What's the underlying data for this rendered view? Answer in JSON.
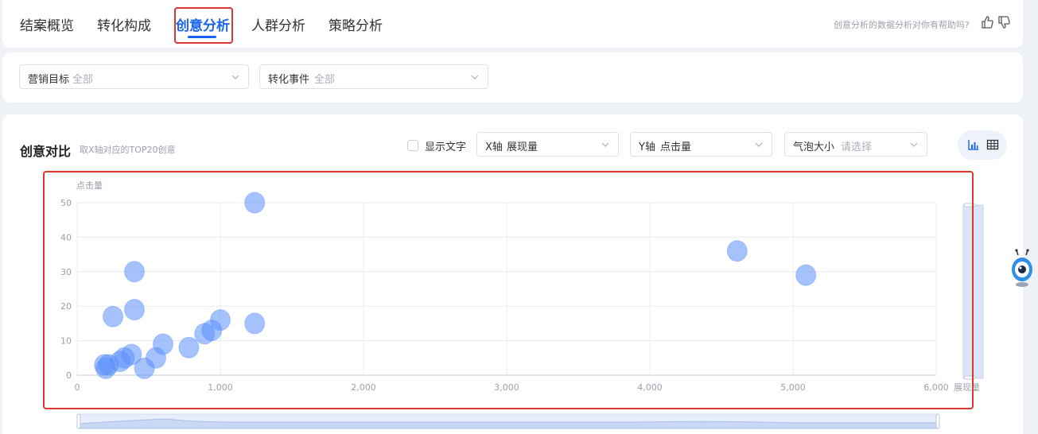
{
  "tabs": [
    {
      "label": "结案概览",
      "active": false
    },
    {
      "label": "转化构成",
      "active": false
    },
    {
      "label": "创意分析",
      "active": true
    },
    {
      "label": "人群分析",
      "active": false
    },
    {
      "label": "策略分析",
      "active": false
    }
  ],
  "help": {
    "question": "创意分析的数据分析对你有帮助吗?",
    "like_icon": "thumbs-up-icon",
    "dislike_icon": "thumbs-down-icon"
  },
  "filters": {
    "marketing_goal": {
      "label": "营销目标",
      "value": "全部"
    },
    "conversion_event": {
      "label": "转化事件",
      "value": "全部"
    }
  },
  "section": {
    "title": "创意对比",
    "subtitle": "取X轴对应的TOP20创意",
    "show_text_label": "显示文字",
    "show_text_checked": false,
    "x_axis": {
      "label": "X轴",
      "value": "展现量"
    },
    "y_axis": {
      "label": "Y轴",
      "value": "点击量"
    },
    "bubble_size": {
      "label": "气泡大小",
      "placeholder": "请选择"
    },
    "view_icons": [
      "bar-chart-icon",
      "table-icon"
    ]
  },
  "colors": {
    "accent": "#1764f0",
    "bubble": "#5b8ff9",
    "highlight_box": "#d93a2c"
  },
  "chart_data": {
    "type": "scatter",
    "xlabel": "展现量",
    "ylabel": "点击量",
    "xlim": [
      0,
      6000
    ],
    "ylim": [
      0,
      50
    ],
    "x_ticks": [
      "0",
      "1,000",
      "2,000",
      "3,000",
      "4,000",
      "5,000",
      "6,000"
    ],
    "y_ticks": [
      "0",
      "10",
      "20",
      "30",
      "40",
      "50"
    ],
    "grid": true,
    "points": [
      {
        "x": 1240,
        "y": 50
      },
      {
        "x": 4610,
        "y": 36
      },
      {
        "x": 5090,
        "y": 29
      },
      {
        "x": 400,
        "y": 30
      },
      {
        "x": 400,
        "y": 19
      },
      {
        "x": 250,
        "y": 17
      },
      {
        "x": 1000,
        "y": 16
      },
      {
        "x": 1240,
        "y": 15
      },
      {
        "x": 940,
        "y": 13
      },
      {
        "x": 890,
        "y": 12
      },
      {
        "x": 600,
        "y": 9
      },
      {
        "x": 780,
        "y": 8
      },
      {
        "x": 380,
        "y": 6
      },
      {
        "x": 550,
        "y": 5
      },
      {
        "x": 330,
        "y": 5
      },
      {
        "x": 300,
        "y": 4
      },
      {
        "x": 470,
        "y": 2
      },
      {
        "x": 220,
        "y": 3
      },
      {
        "x": 190,
        "y": 3
      },
      {
        "x": 200,
        "y": 2
      }
    ]
  }
}
